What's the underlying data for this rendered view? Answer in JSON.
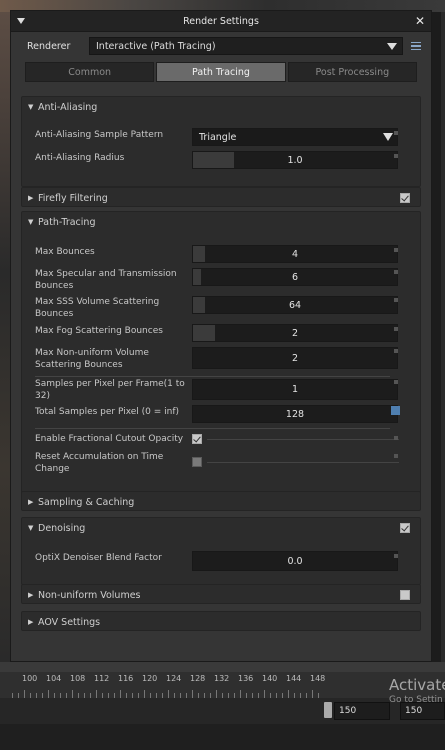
{
  "window": {
    "title": "Render Settings"
  },
  "renderer": {
    "label": "Renderer",
    "value": "Interactive (Path Tracing)"
  },
  "tabs": [
    {
      "label": "Common",
      "active": false
    },
    {
      "label": "Path Tracing",
      "active": true
    },
    {
      "label": "Post Processing",
      "active": false
    }
  ],
  "anti_aliasing": {
    "header": "Anti-Aliasing",
    "sample_pattern": {
      "label": "Anti-Aliasing Sample Pattern",
      "value": "Triangle"
    },
    "radius": {
      "label": "Anti-Aliasing Radius",
      "value": "1.0",
      "fraction": 0.2
    }
  },
  "firefly": {
    "header": "Firefly Filtering",
    "enabled": true
  },
  "path_tracing": {
    "header": "Path-Tracing",
    "max_bounces": {
      "label": "Max Bounces",
      "value": "4",
      "fraction": 0.06
    },
    "max_specular": {
      "label": "Max Specular and Transmission Bounces",
      "value": "6",
      "fraction": 0.04
    },
    "max_sss": {
      "label": "Max SSS Volume Scattering Bounces",
      "value": "64",
      "fraction": 0.06
    },
    "max_fog": {
      "label": "Max Fog Scattering Bounces",
      "value": "2",
      "fraction": 0.11
    },
    "max_nonuniform": {
      "label": "Max Non-uniform Volume Scattering Bounces",
      "value": "2",
      "fraction": 0
    },
    "spp_frame": {
      "label": "Samples per Pixel per Frame(1 to 32)",
      "value": "1",
      "fraction": 0
    },
    "total_spp": {
      "label": "Total Samples per Pixel (0 = inf)",
      "value": "128",
      "fraction": 0
    },
    "fractional_cutout": {
      "label": "Enable Fractional Cutout Opacity",
      "checked": true
    },
    "reset_accumulation": {
      "label": "Reset Accumulation on Time Change",
      "checked": false
    }
  },
  "sampling": {
    "header": "Sampling & Caching"
  },
  "denoising": {
    "header": "Denoising",
    "enabled": true,
    "blend": {
      "label": "OptiX Denoiser Blend Factor",
      "value": "0.0"
    }
  },
  "nonuniform": {
    "header": "Non-uniform Volumes",
    "enabled": false
  },
  "aov": {
    "header": "AOV Settings"
  },
  "timeline": {
    "ticks": [
      "100",
      "104",
      "108",
      "112",
      "116",
      "120",
      "124",
      "128",
      "132",
      "136",
      "140",
      "144",
      "148"
    ],
    "range_start": "150",
    "range_end": "150",
    "watermark_line1": "Activate",
    "watermark_line2": "Go to Settin"
  }
}
